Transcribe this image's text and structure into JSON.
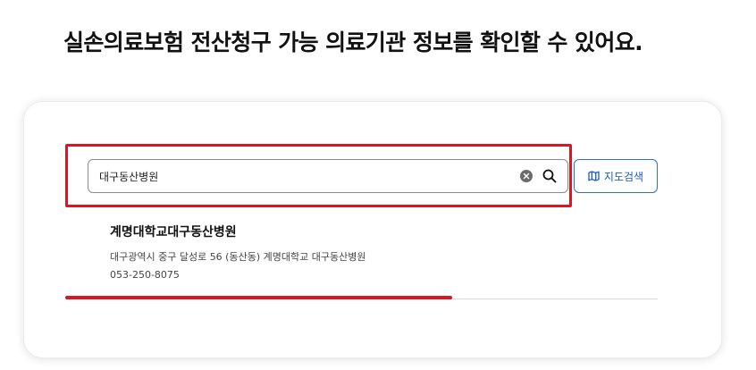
{
  "headline": "실손의료보험 전산청구 가능 의료기관 정보를 확인할 수 있어요.",
  "search": {
    "value": "대구동산병원",
    "clear_icon": "clear-circle-icon",
    "search_icon": "magnifier-icon"
  },
  "map_button": {
    "label": "지도검색",
    "icon": "map-icon",
    "color": "#1d5bbf"
  },
  "results": [
    {
      "name": "계명대학교대구동산병원",
      "address": "대구광역시 중구 달성로 56 (동산동) 계명대학교 대구동산병원",
      "phone": "053-250-8075"
    }
  ],
  "annotation_color": "#e0141e"
}
